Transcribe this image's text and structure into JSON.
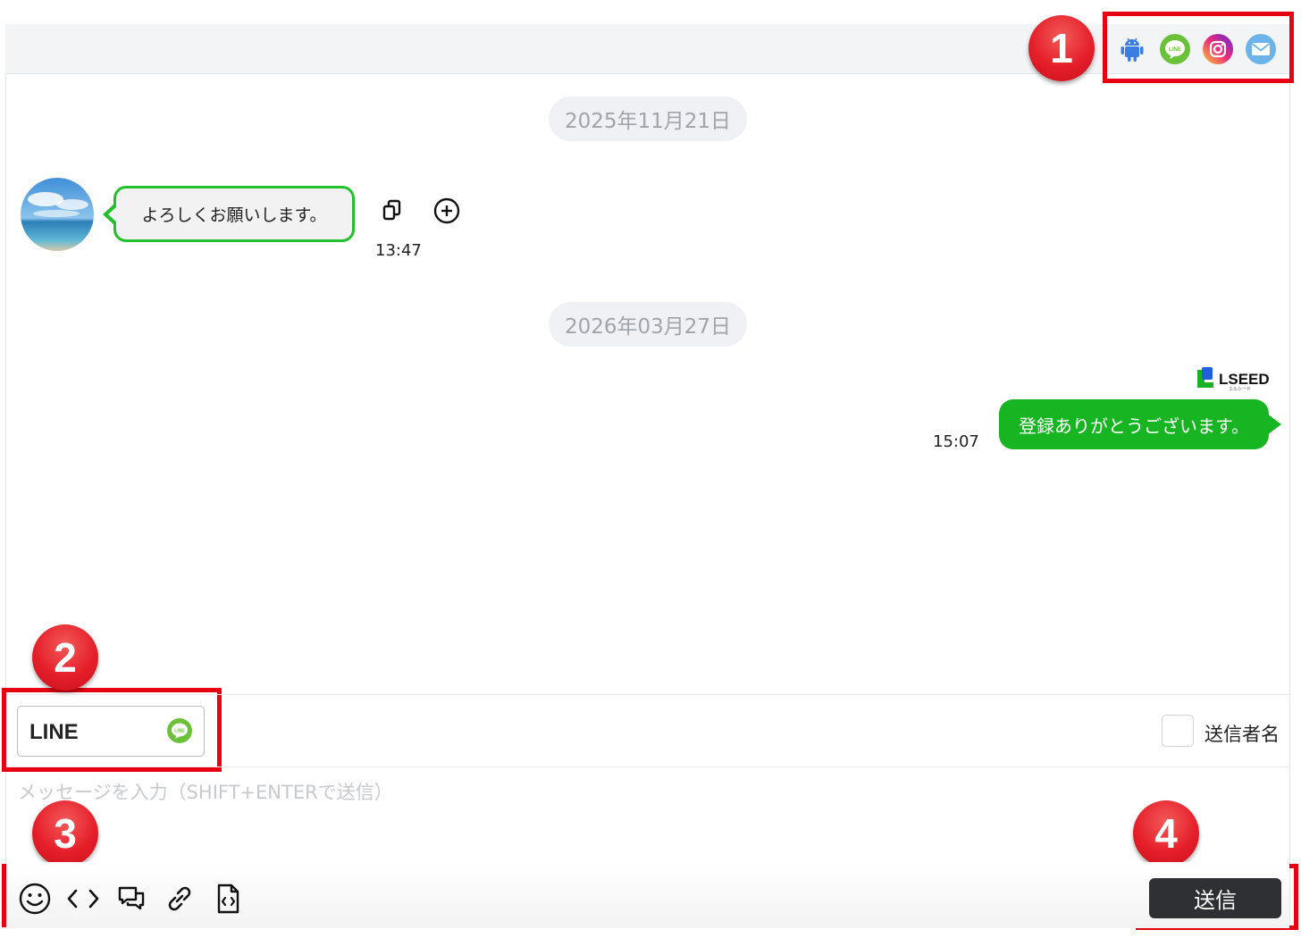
{
  "header": {
    "channel_icons": [
      {
        "name": "android-icon",
        "color": "#3b7de0"
      },
      {
        "name": "line-icon",
        "color": "#6cc13a",
        "label": "LINE"
      },
      {
        "name": "instagram-icon",
        "color": "#d62976"
      },
      {
        "name": "mail-icon",
        "color": "#6bb3e8"
      }
    ]
  },
  "annotations": [
    "1",
    "2",
    "3",
    "4"
  ],
  "chat": {
    "date_1": "2025年11月21日",
    "incoming": {
      "text": "よろしくお願いします。",
      "time": "13:47"
    },
    "date_2": "2026年03月27日",
    "outgoing": {
      "brand": "LSEED",
      "brand_sub": "エルシード",
      "text": "登録ありがとうございます。",
      "time": "15:07"
    }
  },
  "composer": {
    "channel_select": "LINE",
    "channel_badge": "LINE",
    "sender_name_label": "送信者名",
    "input_placeholder": "メッセージを入力（SHIFT+ENTERで送信）",
    "input_value": "",
    "tools": [
      "emoji-icon",
      "code-icon",
      "chat-template-icon",
      "link-icon",
      "file-code-icon"
    ],
    "send_label": "送信"
  },
  "colors": {
    "highlight": "#e60012",
    "incoming_border": "#22c02c",
    "outgoing_bubble": "#18b523",
    "send_button": "#2f3033"
  }
}
